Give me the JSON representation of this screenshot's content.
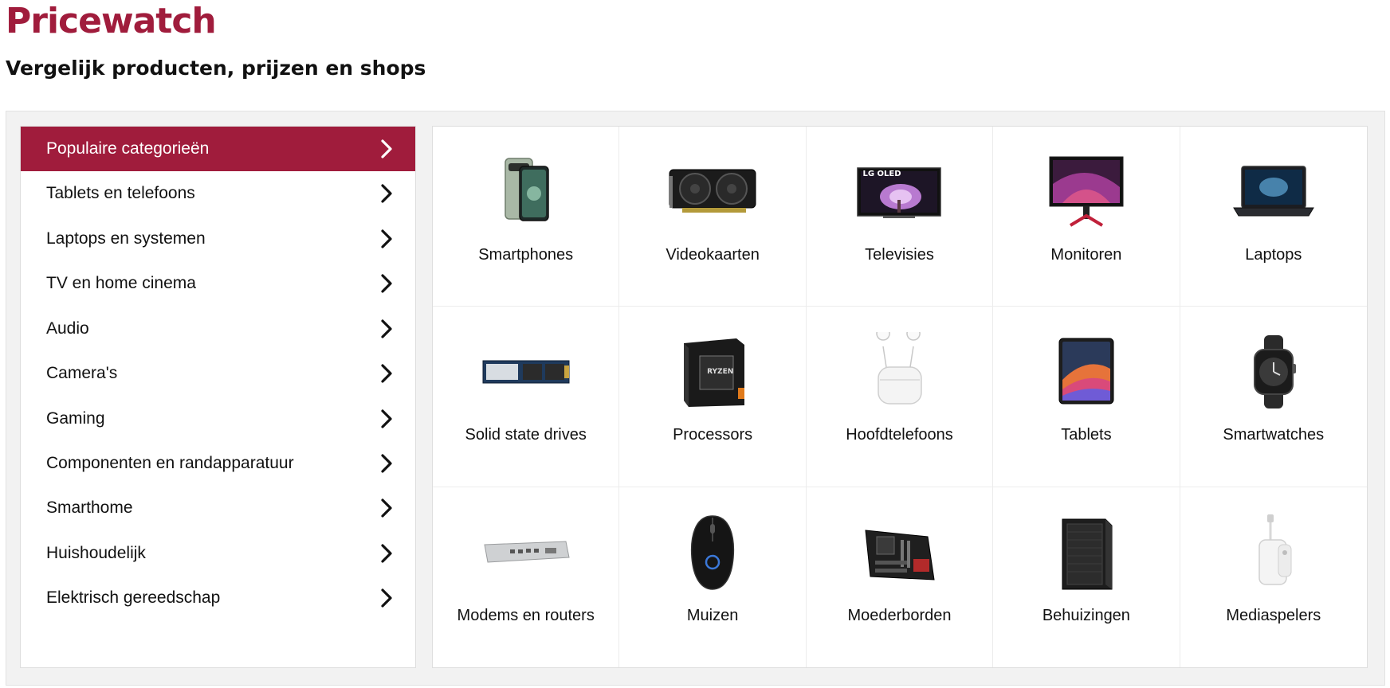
{
  "header": {
    "title": "Pricewatch",
    "subtitle": "Vergelijk producten, prijzen en shops"
  },
  "colors": {
    "accent": "#a01c3c",
    "panel_bg": "#f2f2f2"
  },
  "sidebar": {
    "items": [
      {
        "label": "Populaire categorieën",
        "active": true
      },
      {
        "label": "Tablets en telefoons"
      },
      {
        "label": "Laptops en systemen"
      },
      {
        "label": "TV en home cinema"
      },
      {
        "label": "Audio"
      },
      {
        "label": "Camera's"
      },
      {
        "label": "Gaming"
      },
      {
        "label": "Componenten en randapparatuur"
      },
      {
        "label": "Smarthome"
      },
      {
        "label": "Huishoudelijk"
      },
      {
        "label": "Elektrisch gereedschap"
      }
    ],
    "chevron_icon": "chevron-right-icon"
  },
  "categories": [
    {
      "label": "Smartphones",
      "icon": "smartphone-icon"
    },
    {
      "label": "Videokaarten",
      "icon": "graphics-card-icon"
    },
    {
      "label": "Televisies",
      "icon": "television-icon",
      "brand_text": "LG OLED"
    },
    {
      "label": "Monitoren",
      "icon": "monitor-icon"
    },
    {
      "label": "Laptops",
      "icon": "laptop-icon"
    },
    {
      "label": "Solid state drives",
      "icon": "ssd-icon"
    },
    {
      "label": "Processors",
      "icon": "processor-box-icon",
      "brand_text": "RYZEN"
    },
    {
      "label": "Hoofdtelefoons",
      "icon": "earbuds-icon"
    },
    {
      "label": "Tablets",
      "icon": "tablet-icon"
    },
    {
      "label": "Smartwatches",
      "icon": "smartwatch-icon"
    },
    {
      "label": "Modems en routers",
      "icon": "router-icon"
    },
    {
      "label": "Muizen",
      "icon": "mouse-icon"
    },
    {
      "label": "Moederborden",
      "icon": "motherboard-icon"
    },
    {
      "label": "Behuizingen",
      "icon": "pc-case-icon"
    },
    {
      "label": "Mediaspelers",
      "icon": "media-player-icon"
    }
  ]
}
